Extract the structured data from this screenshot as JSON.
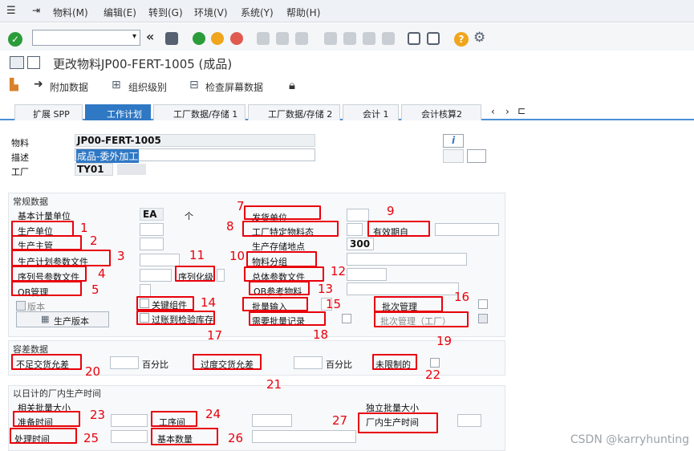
{
  "menu": {
    "items": [
      "物料(M)",
      "编辑(E)",
      "转到(G)",
      "环境(V)",
      "系统(Y)",
      "帮助(H)"
    ]
  },
  "title": "更改物料JP00-FERT-1005 (成品)",
  "app_toolbar": {
    "attachment": "附加数据",
    "org_levels": "组织级别",
    "check_screen": "检查屏幕数据"
  },
  "tabs": [
    "扩展 SPP",
    "工作计划",
    "工厂数据/存储 1",
    "工厂数据/存储 2",
    "会计 1",
    "会计核算2"
  ],
  "header": {
    "material_label": "物料",
    "material_value": "JP00-FERT-1005",
    "desc_label": "描述",
    "desc_value": "成品-委外加工",
    "plant_label": "工厂",
    "plant_value": "TY01"
  },
  "general": {
    "title": "常规数据",
    "base_uom_label": "基本计量单位",
    "base_uom_value": "EA",
    "base_uom_text": "个",
    "prod_unit": "生产单位",
    "prod_supervisor": "生产主管",
    "prod_sched_profile": "生产计划参数文件",
    "serial_profile": "序列号参数文件",
    "serialization": "序列化级",
    "ob_mgmt": "OB管理",
    "version_label": "版本",
    "prod_version_btn": "生产版本",
    "key_component": "关键组件",
    "post_to_insp": "过账到检验库存",
    "issue_unit": "发货单位",
    "plant_status": "工厂特定物料态",
    "valid_from": "有效期自",
    "storage_loc": "生产存储地点",
    "storage_loc_value": "300",
    "material_group": "物料分组",
    "overall_profile": "总体参数文件",
    "ob_ref_material": "OB参考物料",
    "batch_entry": "批量输入",
    "batch_mgmt": "批次管理",
    "batch_record_req": "需要批量记录",
    "batch_mgmt_plant": "批次管理（工厂）"
  },
  "tolerance": {
    "title": "容差数据",
    "under_delivery": "不足交货允差",
    "pct1": "百分比",
    "over_delivery": "过度交货允差",
    "pct2": "百分比",
    "unlimited": "未限制的"
  },
  "inhouse": {
    "title": "以日计的厂内生产时间",
    "dep_lot_size": "相关批量大小",
    "indep_lot_size": "独立批量大小",
    "setup_time": "准备时间",
    "interoperation": "工序间",
    "inhouse_prod_time": "厂内生产时间",
    "processing_time": "处理时间",
    "base_quantity": "基本数量"
  },
  "watermark": "CSDN @karryhunting",
  "colors": {
    "accent": "#2f78c4",
    "annotation": "#e8000b"
  }
}
